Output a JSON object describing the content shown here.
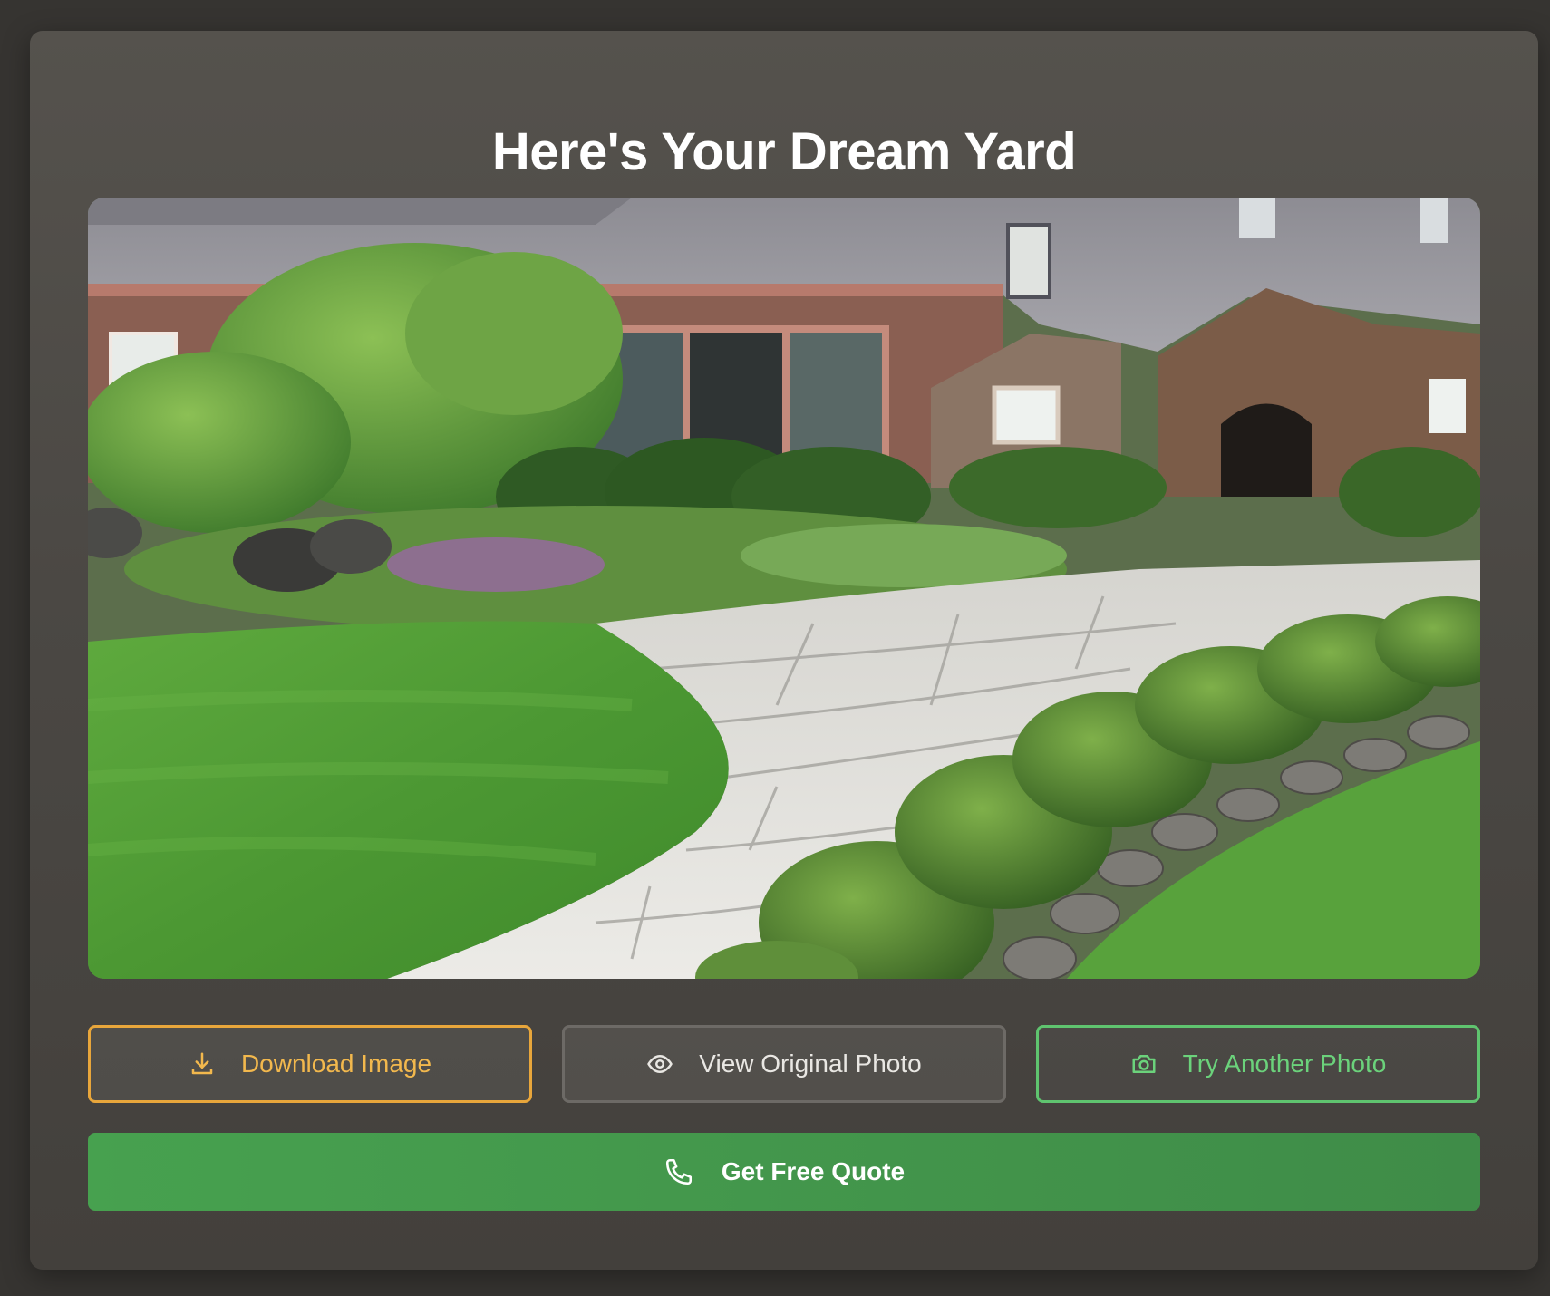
{
  "page": {
    "title": "Here's Your Dream Yard"
  },
  "preview": {
    "image_description_icon": "landscape-photo"
  },
  "actions": {
    "download_label": "Download Image",
    "download_icon": "download-icon",
    "view_original_label": "View Original Photo",
    "view_original_icon": "eye-icon",
    "try_another_label": "Try Another Photo",
    "try_another_icon": "camera-icon",
    "quote_label": "Get Free Quote",
    "quote_icon": "phone-icon"
  },
  "colors": {
    "download_accent": "#e8a63b",
    "try_another_accent": "#5fc46f",
    "quote_bg": "#47a14f",
    "card_bg": "#4b4844"
  }
}
